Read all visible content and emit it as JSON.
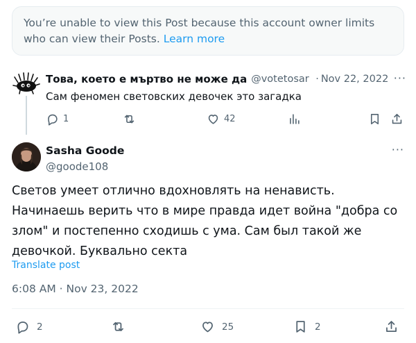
{
  "notice": {
    "text": "You’re unable to view this Post because this account owner limits who can view their Posts.",
    "link": "Learn more"
  },
  "parent_tweet": {
    "name": "Това, което е мъртво не може да",
    "handle": "@votetosar",
    "separator": "·",
    "date": "Nov 22, 2022",
    "more": "···",
    "text": "Сам феномен световских девочек это загадка",
    "replies": "1",
    "retweets": "",
    "likes": "42",
    "views": ""
  },
  "main_tweet": {
    "name": "Sasha Goode",
    "handle": "@goode108",
    "more": "···",
    "text": "Светов умеет отлично вдохновлять на ненависть. Начинаешь верить что в мире правда идет война \"добра со злом\" и постепенно сходишь с ума. Сам был такой же девочкой. Буквально секта",
    "translate": "Translate post",
    "timestamp": "6:08 AM · Nov 23, 2022",
    "replies": "2",
    "retweets": "",
    "likes": "25",
    "bookmarks": "2"
  },
  "colors": {
    "accent": "#1d9bf0",
    "secondary_text": "#536471",
    "primary_text": "#0f1419"
  }
}
